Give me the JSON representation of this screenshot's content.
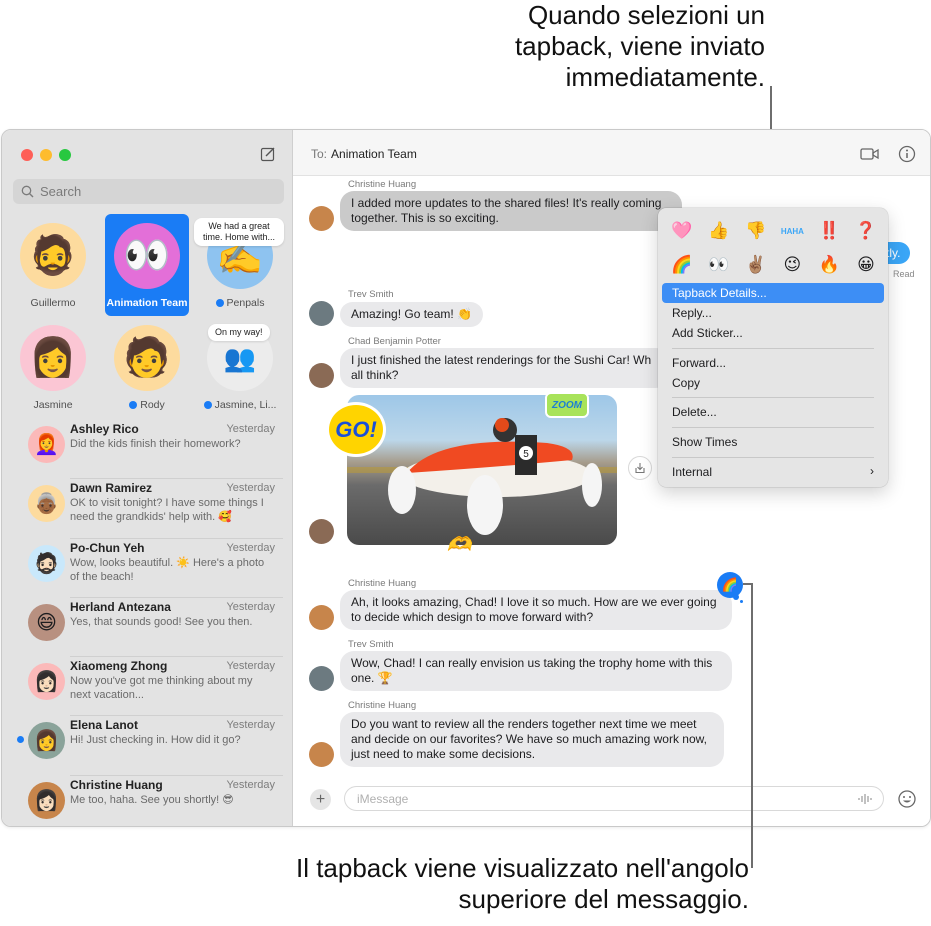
{
  "annotations": {
    "top": [
      "Quando selezioni un",
      "tapback, viene inviato",
      "immediatamente."
    ],
    "bottom": [
      "Il tapback viene visualizzato nell'angolo",
      "superiore del messaggio."
    ]
  },
  "sidebar": {
    "search_placeholder": "Search",
    "compose_icon": "compose-icon",
    "pinned": [
      {
        "name": "Guillermo",
        "avatar": "🧔",
        "bg": "#fddb9e",
        "unread": false,
        "selected": false
      },
      {
        "name": "Animation Team",
        "avatar": "👀",
        "bg": "#e36fd8",
        "unread": false,
        "selected": true
      },
      {
        "name": "Penpals",
        "avatar": "✍️",
        "bg": "#8ec3f0",
        "unread": true,
        "selected": false,
        "bubble": "We had a great time. Home with..."
      },
      {
        "name": "Jasmine",
        "avatar": "👩",
        "bg": "#fbc6d4",
        "unread": false,
        "selected": false
      },
      {
        "name": "Rody",
        "avatar": "🧑",
        "bg": "#fddb9e",
        "unread": true,
        "selected": false
      },
      {
        "name": "Jasmine, Li...",
        "avatar": "👥",
        "bg": "#ececec",
        "unread": true,
        "selected": false,
        "bubble": "On my way!"
      }
    ],
    "conversations": [
      {
        "name": "Ashley Rico",
        "time": "Yesterday",
        "preview": "Did the kids finish their homework?",
        "avatar": "👩‍🦰",
        "bg": "#fbb9b9",
        "unread": false
      },
      {
        "name": "Dawn Ramirez",
        "time": "Yesterday",
        "preview": "OK to visit tonight? I have some things I need the grandkids' help with. 🥰",
        "avatar": "👵🏾",
        "bg": "#fddb9e",
        "unread": false
      },
      {
        "name": "Po-Chun Yeh",
        "time": "Yesterday",
        "preview": "Wow, looks beautiful. ☀️ Here's a photo of the beach!",
        "avatar": "🧔🏻",
        "bg": "#c9e8fb",
        "unread": false
      },
      {
        "name": "Herland Antezana",
        "time": "Yesterday",
        "preview": "Yes, that sounds good! See you then.",
        "avatar": "😄",
        "bg": "#b89080",
        "unread": false
      },
      {
        "name": "Xiaomeng Zhong",
        "time": "Yesterday",
        "preview": "Now you've got me thinking about my next vacation...",
        "avatar": "👩🏻",
        "bg": "#fbb9b9",
        "unread": false
      },
      {
        "name": "Elena Lanot",
        "time": "Yesterday",
        "preview": "Hi! Just checking in. How did it go?",
        "avatar": "👩",
        "bg": "#8aa39a",
        "unread": true
      },
      {
        "name": "Christine Huang",
        "time": "Yesterday",
        "preview": "Me too, haha. See you shortly! 😎",
        "avatar": "👩🏻",
        "bg": "#c7854b",
        "unread": false
      }
    ]
  },
  "chat": {
    "to_label": "To:",
    "recipient": "Animation Team",
    "video_icon": "video-camera-icon",
    "info_icon": "info-icon",
    "messages": [
      {
        "sender": "Christine Huang",
        "text": "I added more updates to the shared files! It's really coming together. This is so exciting.",
        "avatar": "👩🏻",
        "bg": "#c7854b"
      },
      {
        "sender": "Trev Smith",
        "text": "Amazing! Go team! 👏",
        "avatar": "🧑🏻",
        "bg": "#6c7a80"
      },
      {
        "sender": "Chad Benjamin Potter",
        "text": "I just finished the latest renderings for the Sushi Car! What do you all think?",
        "avatar": "🧑🏽",
        "bg": "#8a6a55"
      },
      {
        "sender": "Christine Huang",
        "text": "Ah, it looks amazing, Chad! I love it so much. How are we ever going to decide which design to move forward with?",
        "avatar": "👩🏻",
        "bg": "#c7854b",
        "tapback": "🌈"
      },
      {
        "sender": "Trev Smith",
        "text": "Wow, Chad! I can really envision us taking the trophy home with this one. 🏆",
        "avatar": "🧑🏻",
        "bg": "#6c7a80"
      },
      {
        "sender": "Christine Huang",
        "text": "Do you want to review all the renders together next time we meet and decide on our favorites? We have so much amazing work now, just need to make some decisions.",
        "avatar": "👩🏻",
        "bg": "#c7854b"
      }
    ],
    "chad_line1": "I just finished the latest renderings for the Sushi Car! Wh",
    "chad_line2": "all think?",
    "sent_fragment": "tly.",
    "read_receipt": "Read",
    "photo": {
      "stickers": [
        "GO!",
        "ZOOM",
        "🫶"
      ],
      "car_number": "5"
    },
    "composer_placeholder": "iMessage"
  },
  "context_menu": {
    "tapbacks_row1": [
      "🩷",
      "👍",
      "👎",
      "HAHA",
      "‼️",
      "❓"
    ],
    "tapbacks_row2": [
      "🌈",
      "👀",
      "✌🏽",
      "😉",
      "🔥",
      "😀"
    ],
    "items": [
      {
        "label": "Tapback Details...",
        "active": true
      },
      {
        "label": "Reply...",
        "active": false
      },
      {
        "label": "Add Sticker...",
        "active": false
      },
      {
        "label": "Forward...",
        "active": false
      },
      {
        "label": "Copy",
        "active": false
      },
      {
        "label": "Delete...",
        "active": false
      },
      {
        "label": "Show Times",
        "active": false
      },
      {
        "label": "Internal",
        "active": false,
        "submenu": true
      }
    ],
    "submenu_chevron": "›"
  }
}
